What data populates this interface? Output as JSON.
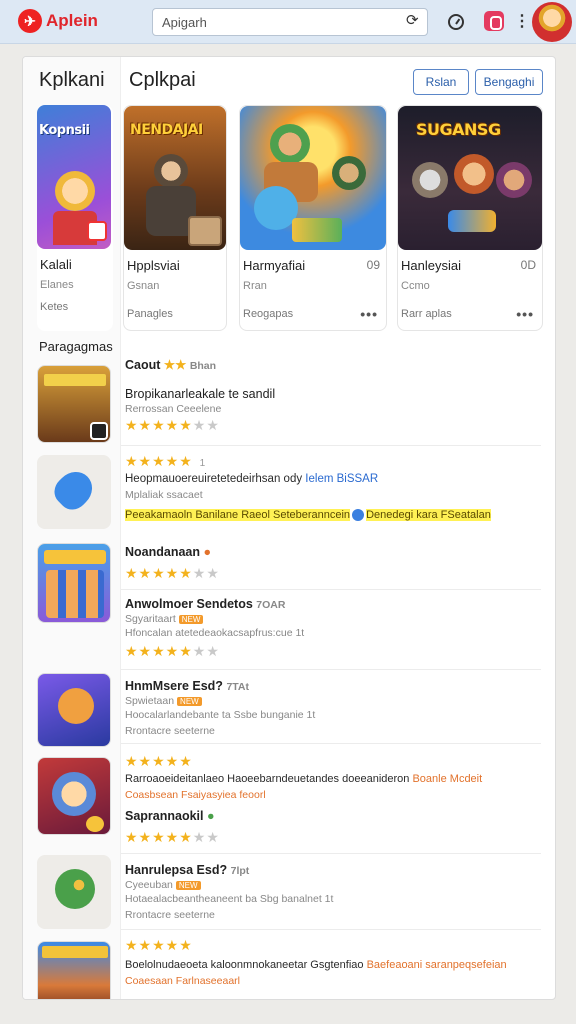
{
  "topbar": {
    "app_name": "Aplein",
    "search_value": "Apigarh"
  },
  "panel": {
    "left_heading": "Kplkani",
    "main_heading": "Cplkpai",
    "btn_a": "Rslan",
    "btn_b": "Bengaghi",
    "section_label": "Paragagmas"
  },
  "featured": [
    {
      "img_title": "Kopnsii",
      "title": "Kalali",
      "size": "",
      "sub": "Elanes",
      "meta": "Ketes"
    },
    {
      "img_title": "NENDAJAI",
      "title": "Hpplsviai",
      "size": "",
      "sub": "Gsnan",
      "meta": "Panagles"
    },
    {
      "img_title": "",
      "title": "Harmyafiai",
      "size": "09",
      "sub": "Rran",
      "meta": "Reogapas"
    },
    {
      "img_title": "SUGANSG",
      "title": "Hanleysiai",
      "size": "0D",
      "sub": "Ccmo",
      "meta": "Rarr aplas"
    }
  ],
  "list": {
    "r1_title": "Caout",
    "r1_count": "Bhan",
    "r2_title": "Bropikanarleakale te sandil",
    "r2_sub": "Rerrossan Ceeelene",
    "r3_title": "Heopmauoereuiretetedeirhsan ody",
    "r3_link": "Ielem BiSSAR",
    "r3_sub": "Mplaliak ssacaet",
    "r3_hl1": "Peeakamaoln Banilane Raeol Seteberanncein",
    "r3_hl2": "Denedegi kara FSeatalan",
    "r4_title": "Noandanaan",
    "r5_title": "Anwolmoer Sendetos",
    "r5_size": "7OAR",
    "r5_sub1": "Sgyaritaart",
    "r5_sub2": "Hfoncalan atetedeaokacsapfrus:cue 1t",
    "r6_title": "HnmMsere Esd?",
    "r6_size": "7TAt",
    "r6_sub1": "Spwietaan",
    "r6_sub2": "Hoocalarlandebante ta Ssbe bunganie 1t",
    "r6_sub3": "Rrontacre seeterne",
    "r7_title": "Rarroaoeideitanlaeo Haoeebarndeuetandes doeeanideron",
    "r7_orange": "Boanle Mcdeit",
    "r7_sub": "Coasbsean Fsaiyasyiea feoorl",
    "r8_title": "Saprannaokil",
    "r9_title": "Hanrulepsa Esd?",
    "r9_size": "7lpt",
    "r9_sub1": "Cyeeuban",
    "r9_sub2": "Hotaealacbeantheaneent ba Sbg banalnet 1t",
    "r9_sub3": "Rrontacre seeterne",
    "r10_title": "Boelolnudaeoeta kaloonmnokaneetar Gsgtenfiao",
    "r10_orange": "Baefeaoani saranpeqsefeian",
    "r10_sub": "Coaesaan Farlnaseeaarl"
  },
  "colors": {
    "accent": "#e0252b",
    "star": "#f3b21d",
    "link": "#2a6ad0",
    "highlight": "#fff155"
  }
}
